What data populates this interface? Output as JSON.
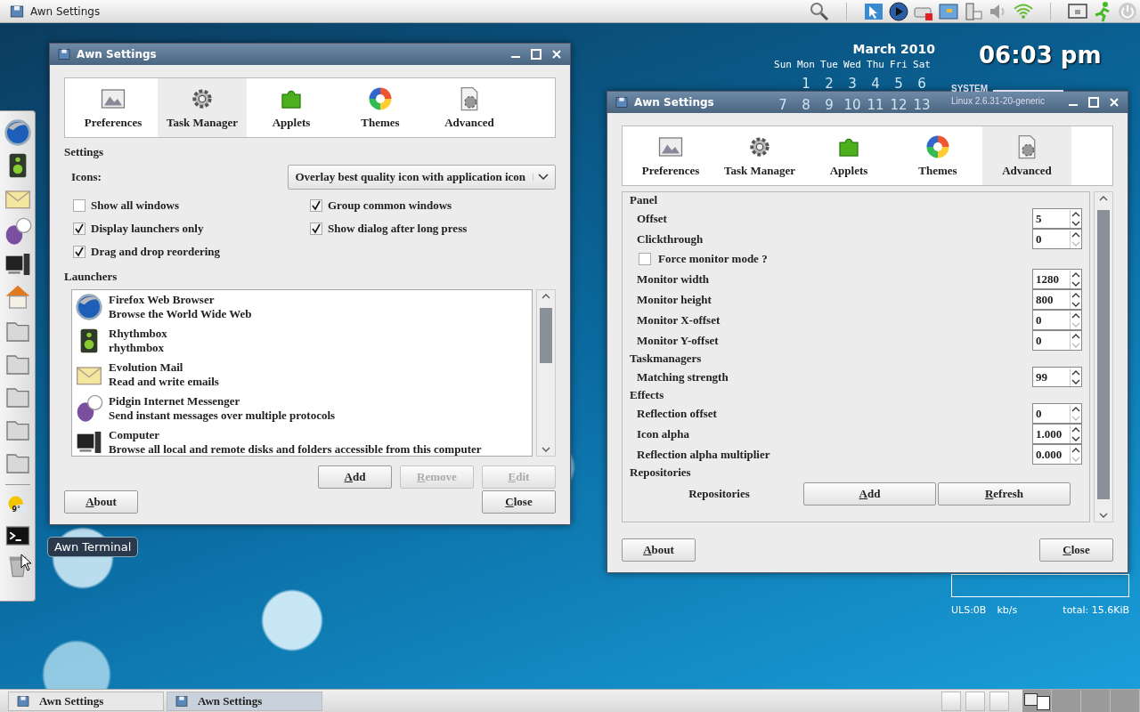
{
  "top_panel": {
    "title": "Awn Settings"
  },
  "calendar": {
    "month": "March 2010",
    "weekdays": [
      "Sun",
      "Mon",
      "Tue",
      "Wed",
      "Thu",
      "Fri",
      "Sat"
    ],
    "weeks": [
      [
        "1",
        "2",
        "3",
        "4",
        "5",
        "6"
      ],
      [
        "7",
        "8",
        "9",
        "10",
        "11",
        "12",
        "13"
      ]
    ]
  },
  "clock": "06:03 pm",
  "system": {
    "heading": "SYSTEM",
    "kernel": "Linux 2.6.31-20-generic"
  },
  "network": {
    "upload": "ULS:0B",
    "unit": "kb/s",
    "total": "total: 15.6KiB"
  },
  "dock": {
    "weather_temp": "9°",
    "tooltip": "Awn Terminal"
  },
  "windows": [
    {
      "kind": "task_manager",
      "title": "Awn Settings",
      "tabs": [
        {
          "label": "Preferences",
          "selected": false
        },
        {
          "label": "Task Manager",
          "selected": true
        },
        {
          "label": "Applets",
          "selected": false
        },
        {
          "label": "Themes",
          "selected": false
        },
        {
          "label": "Advanced",
          "selected": false
        }
      ],
      "settings_heading": "Settings",
      "icons_label": "Icons:",
      "icons_value": "Overlay best quality icon with application icon",
      "options": [
        {
          "label": "Show all windows",
          "checked": false
        },
        {
          "label": "Group common windows",
          "checked": true
        },
        {
          "label": "Display launchers only",
          "checked": true
        },
        {
          "label": "Show dialog after long press",
          "checked": true
        },
        {
          "label": "Drag and drop reordering",
          "checked": true
        }
      ],
      "launchers_heading": "Launchers",
      "launchers": [
        {
          "name": "Firefox Web Browser",
          "description": "Browse the World Wide Web"
        },
        {
          "name": "Rhythmbox",
          "description": "rhythmbox"
        },
        {
          "name": "Evolution Mail",
          "description": "Read and write emails"
        },
        {
          "name": "Pidgin Internet Messenger",
          "description": "Send instant messages over multiple protocols"
        },
        {
          "name": "Computer",
          "description": "Browse all local and remote disks and folders accessible from this computer"
        }
      ],
      "list_buttons": [
        {
          "label": "Add",
          "disabled": false
        },
        {
          "label": "Remove",
          "disabled": true
        },
        {
          "label": "Edit",
          "disabled": true
        }
      ],
      "about": "About",
      "close": "Close"
    },
    {
      "kind": "advanced",
      "title": "Awn Settings",
      "tabs": [
        {
          "label": "Preferences",
          "selected": false
        },
        {
          "label": "Task Manager",
          "selected": false
        },
        {
          "label": "Applets",
          "selected": false
        },
        {
          "label": "Themes",
          "selected": false
        },
        {
          "label": "Advanced",
          "selected": true
        }
      ],
      "rows": [
        {
          "kind": "heading",
          "label": "Panel"
        },
        {
          "kind": "spin",
          "label": "Offset",
          "value": "5",
          "at_minimum": false
        },
        {
          "kind": "spin",
          "label": "Clickthrough",
          "value": "0",
          "at_minimum": true
        },
        {
          "kind": "check",
          "label": "Force monitor mode ?",
          "checked": false
        },
        {
          "kind": "spin",
          "label": "Monitor width",
          "value": "1280",
          "at_minimum": false
        },
        {
          "kind": "spin",
          "label": "Monitor height",
          "value": "800",
          "at_minimum": false
        },
        {
          "kind": "spin",
          "label": "Monitor X-offset",
          "value": "0",
          "at_minimum": true
        },
        {
          "kind": "spin",
          "label": "Monitor Y-offset",
          "value": "0",
          "at_minimum": true
        },
        {
          "kind": "heading",
          "label": "Taskmanagers"
        },
        {
          "kind": "spin",
          "label": "Matching strength",
          "value": "99",
          "at_minimum": false
        },
        {
          "kind": "heading",
          "label": "Effects"
        },
        {
          "kind": "spin",
          "label": "Reflection offset",
          "value": "0",
          "at_minimum": true
        },
        {
          "kind": "spin",
          "label": "Icon alpha",
          "value": "1.000",
          "at_minimum": false
        },
        {
          "kind": "spin",
          "label": "Reflection alpha multiplier",
          "value": "0.000",
          "at_minimum": true
        },
        {
          "kind": "heading",
          "label": "Repositories"
        },
        {
          "kind": "buttons",
          "label": "Repositories",
          "buttons": [
            "Add",
            "Refresh"
          ]
        }
      ],
      "about": "About",
      "close": "Close"
    }
  ],
  "taskbar": {
    "tasks": [
      {
        "label": "Awn Settings",
        "selected": false
      },
      {
        "label": "Awn Settings",
        "selected": true
      }
    ]
  }
}
